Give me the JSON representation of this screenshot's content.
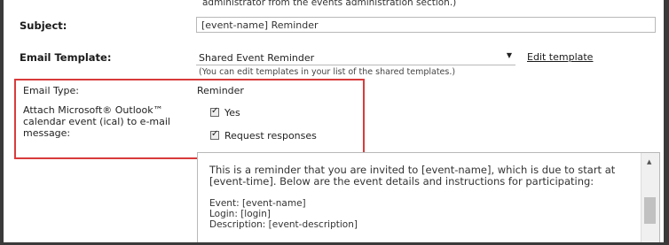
{
  "top_note": "administrator from the events administration section.)",
  "subject": {
    "label": "Subject:",
    "value": "[event-name] Reminder"
  },
  "template": {
    "label": "Email Template:",
    "selected": "Shared Event Reminder",
    "edit_link": "Edit template",
    "note": "(You can edit templates in your list of the shared templates.)"
  },
  "email_type": {
    "label": "Email Type:",
    "value": "Reminder"
  },
  "attach": {
    "label": "Attach Microsoft® Outlook™ calendar event (ical) to e-mail message:",
    "options": [
      {
        "label": "Yes",
        "checked": true
      },
      {
        "label": "Request responses",
        "checked": true
      }
    ]
  },
  "editor": {
    "paragraph": "This is a reminder that you are invited to [event-name], which is due to start at [event-time]. Below are the event details and instructions for participating:",
    "lines": [
      "Event: [event-name]",
      "Login: [login]",
      "Description: [event-description]"
    ]
  }
}
